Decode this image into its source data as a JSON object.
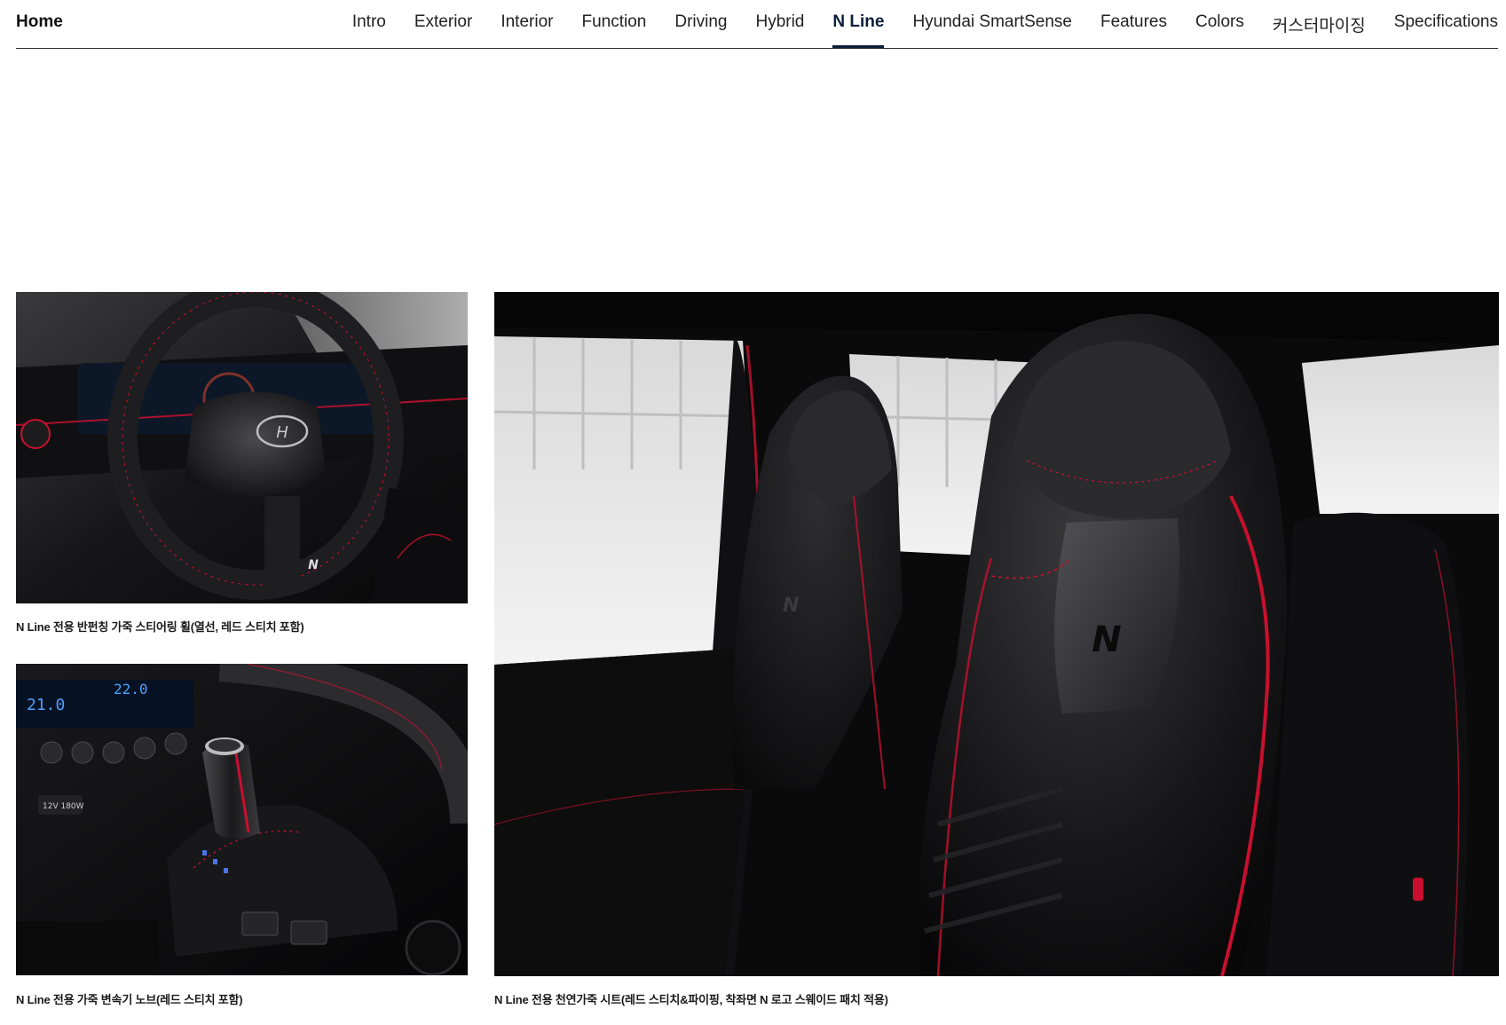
{
  "nav": {
    "home_label": "Home",
    "tabs": [
      {
        "label": "Intro",
        "active": false
      },
      {
        "label": "Exterior",
        "active": false
      },
      {
        "label": "Interior",
        "active": false
      },
      {
        "label": "Function",
        "active": false
      },
      {
        "label": "Driving",
        "active": false
      },
      {
        "label": "Hybrid",
        "active": false
      },
      {
        "label": "N Line",
        "active": true
      },
      {
        "label": "Hyundai SmartSense",
        "active": false
      },
      {
        "label": "Features",
        "active": false
      },
      {
        "label": "Colors",
        "active": false
      },
      {
        "label": "커스터마이징",
        "active": false
      },
      {
        "label": "Specifications",
        "active": false
      }
    ]
  },
  "gallery": {
    "steering_caption": "N Line 전용 반펀칭 가죽 스티어링 휠(열선, 레드 스티치 포함)",
    "shifter_caption": "N Line 전용 가죽 변속기 노브(레드 스티치 포함)",
    "seats_caption": "N Line 전용 천연가죽 시트(레드 스티치&파이핑, 착좌면 N 로고 스웨이드 패치 적용)",
    "hyundai_logo_text": "H",
    "n_logo_text": "N",
    "climate_temp_left": "21.0",
    "climate_temp_right": "22.0",
    "usb_label": "12V 180W"
  },
  "colors": {
    "accent_red": "#c8102e",
    "nav_active": "#0b1f3a",
    "leather_black": "#141416"
  }
}
